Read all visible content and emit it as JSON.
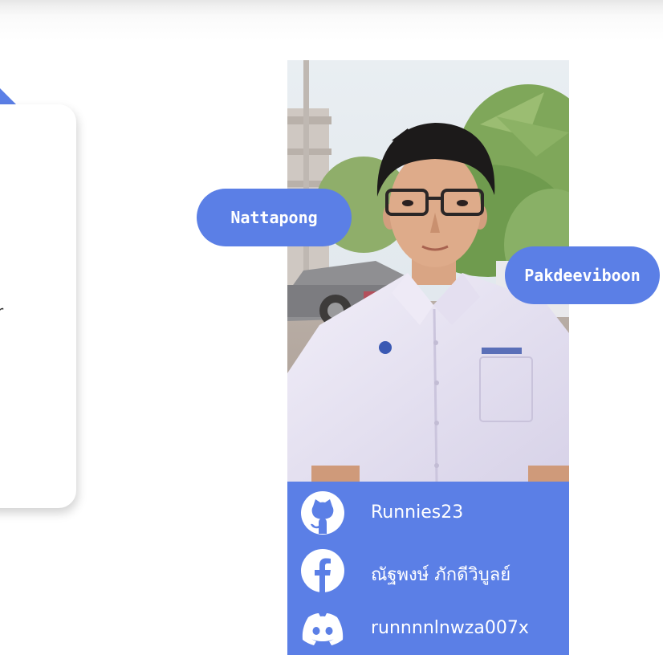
{
  "left_card": {
    "partial_text": "r"
  },
  "profile": {
    "first_name": "Nattapong",
    "last_name": "Pakdeeviboon",
    "links": [
      {
        "icon": "github-icon",
        "label": "Runnies23"
      },
      {
        "icon": "facebook-icon",
        "label": "ณัฐพงษ์ ภักดีวิบูลย์"
      },
      {
        "icon": "discord-icon",
        "label": "runnnnlnwza007x"
      }
    ]
  },
  "colors": {
    "accent": "#5b7fe6",
    "background": "#ffffff",
    "label_text": "#ffffff"
  }
}
